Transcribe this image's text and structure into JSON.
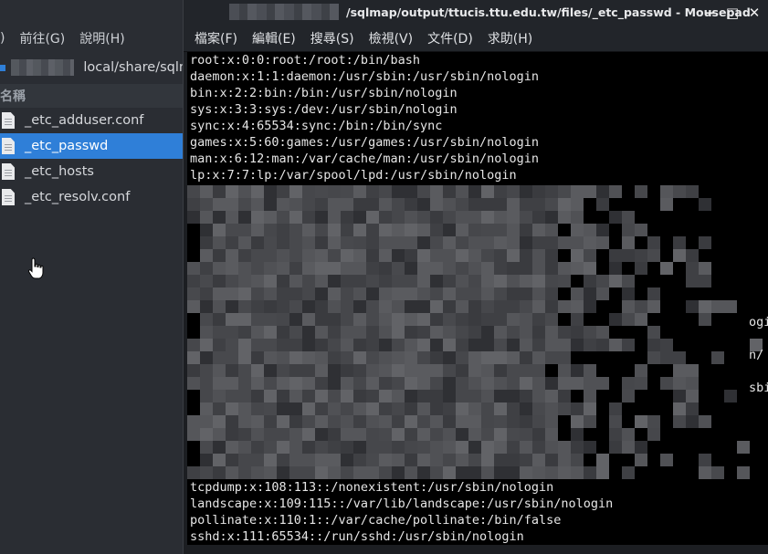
{
  "file_manager": {
    "menu": [
      ")",
      "前往(G)",
      "說明(H)"
    ],
    "path_text": "local/share/sqlm",
    "column_header": "名稱",
    "files": [
      {
        "name": "_etc_adduser.conf",
        "selected": false
      },
      {
        "name": "_etc_passwd",
        "selected": true
      },
      {
        "name": "_etc_hosts",
        "selected": false
      },
      {
        "name": "_etc_resolv.conf",
        "selected": false
      }
    ]
  },
  "editor": {
    "title": "/sqlmap/output/ttucis.ttu.edu.tw/files/_etc_passwd - Mousepad",
    "window_controls": {
      "minimize": "−",
      "maximize": "□",
      "close": "✕"
    },
    "menu": [
      "檔案(F)",
      "編輯(E)",
      "搜尋(S)",
      "檢視(V)",
      "文件(D)",
      "求助(H)"
    ],
    "lines_top": [
      "root:x:0:0:root:/root:/bin/bash",
      "daemon:x:1:1:daemon:/usr/sbin:/usr/sbin/nologin",
      "bin:x:2:2:bin:/bin:/usr/sbin/nologin",
      "sys:x:3:3:sys:/dev:/usr/sbin/nologin",
      "sync:x:4:65534:sync:/bin:/bin/sync",
      "games:x:5:60:games:/usr/games:/usr/sbin/nologin",
      "man:x:6:12:man:/var/cache/man:/usr/sbin/nologin",
      "lp:x:7:7:lp:/var/spool/lpd:/usr/sbin/nologin"
    ],
    "redacted_fragments": [
      {
        "text": "ogi"
      },
      {
        "text": "n/"
      },
      {
        "text": "sbi"
      }
    ],
    "lines_bottom": [
      "tcpdump:x:108:113::/nonexistent:/usr/sbin/nologin",
      "landscape:x:109:115::/var/lib/landscape:/usr/sbin/nologin",
      "pollinate:x:110:1::/var/cache/pollinate:/bin/false",
      "sshd:x:111:65534::/run/sshd:/usr/sbin/nologin"
    ]
  }
}
